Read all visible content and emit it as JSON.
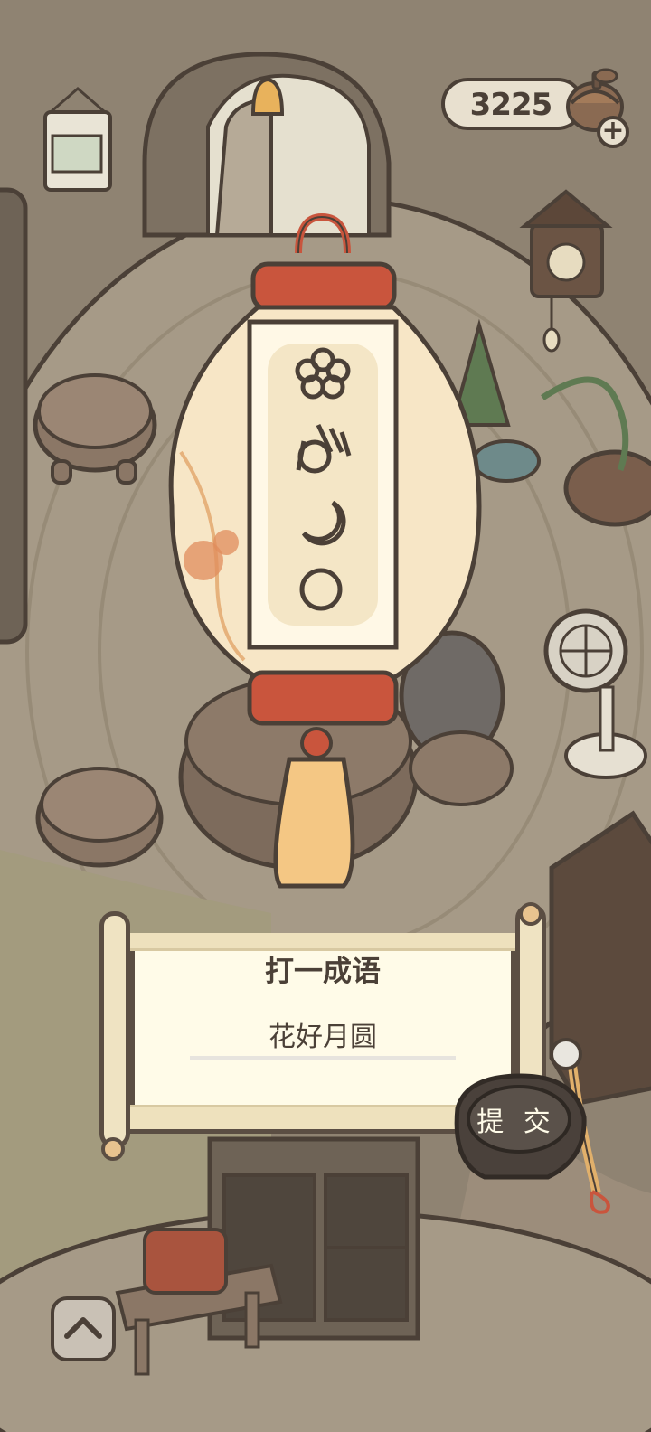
{
  "hud": {
    "coin_count": "3225",
    "add_icon": "plus-icon",
    "coin_icon": "acorn-icon"
  },
  "lantern": {
    "glyphs": [
      "flower-icon",
      "ok-hand-icon",
      "crescent-moon-icon",
      "full-moon-circle-icon"
    ]
  },
  "riddle": {
    "title": "打一成语",
    "answer_value": "花好月圆"
  },
  "actions": {
    "submit_label": "提 交",
    "expand_icon": "chevron-up-icon"
  },
  "colors": {
    "outline": "#4b4037",
    "paper": "#fffbe8",
    "lantern_red": "#c9553d",
    "ink_stone": "#4a413b"
  }
}
